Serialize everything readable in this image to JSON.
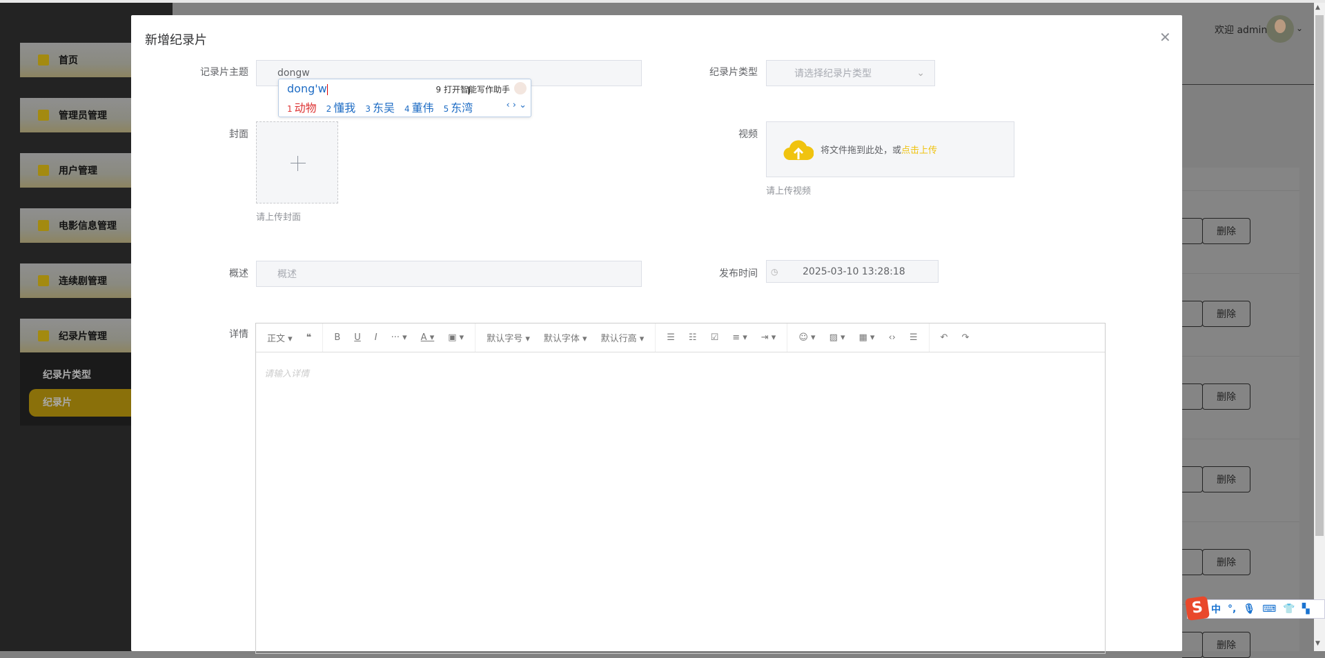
{
  "sidebar": {
    "items": [
      {
        "label": "首页",
        "icon": "home-icon"
      },
      {
        "label": "管理员管理",
        "icon": "gear-icon"
      },
      {
        "label": "用户管理",
        "icon": "user-icon"
      },
      {
        "label": "电影信息管理",
        "icon": "film-icon"
      },
      {
        "label": "连续剧管理",
        "icon": "series-icon"
      },
      {
        "label": "纪录片管理",
        "icon": "documentary-icon"
      }
    ],
    "submenu": [
      {
        "label": "纪录片类型"
      },
      {
        "label": "纪录片",
        "active": true
      }
    ]
  },
  "header": {
    "welcome": "欢迎 admin"
  },
  "table": {
    "delete_label": "删除",
    "rows": 6
  },
  "modal": {
    "title": "新增纪录片",
    "fields": {
      "subject": {
        "label": "记录片主题",
        "value": "dongw"
      },
      "type": {
        "label": "纪录片类型",
        "placeholder": "请选择纪录片类型"
      },
      "cover": {
        "label": "封面",
        "hint": "请上传封面"
      },
      "video": {
        "label": "视频",
        "drop_text": "将文件拖到此处，或",
        "link_text": "点击上传",
        "hint": "请上传视频"
      },
      "summary": {
        "label": "概述",
        "placeholder": "概述"
      },
      "publish_time": {
        "label": "发布时间",
        "value": "2025-03-10 13:28:18"
      },
      "details": {
        "label": "详情",
        "placeholder": "请输入详情"
      }
    },
    "toolbar": {
      "paragraph": "正文",
      "font_size": "默认字号",
      "font_family": "默认字体",
      "line_height": "默认行高"
    }
  },
  "ime": {
    "pinyin": "dong'w",
    "assistant": "9 打开智能写作助手",
    "candidates": [
      {
        "n": "1",
        "text": "动物"
      },
      {
        "n": "2",
        "text": "懂我"
      },
      {
        "n": "3",
        "text": "东吴"
      },
      {
        "n": "4",
        "text": "董伟"
      },
      {
        "n": "5",
        "text": "东湾"
      }
    ]
  },
  "sogou": {
    "lang": "中",
    "punct": "°,"
  },
  "colors": {
    "accent": "#f0c30f",
    "active_menu": "#8a700a"
  }
}
